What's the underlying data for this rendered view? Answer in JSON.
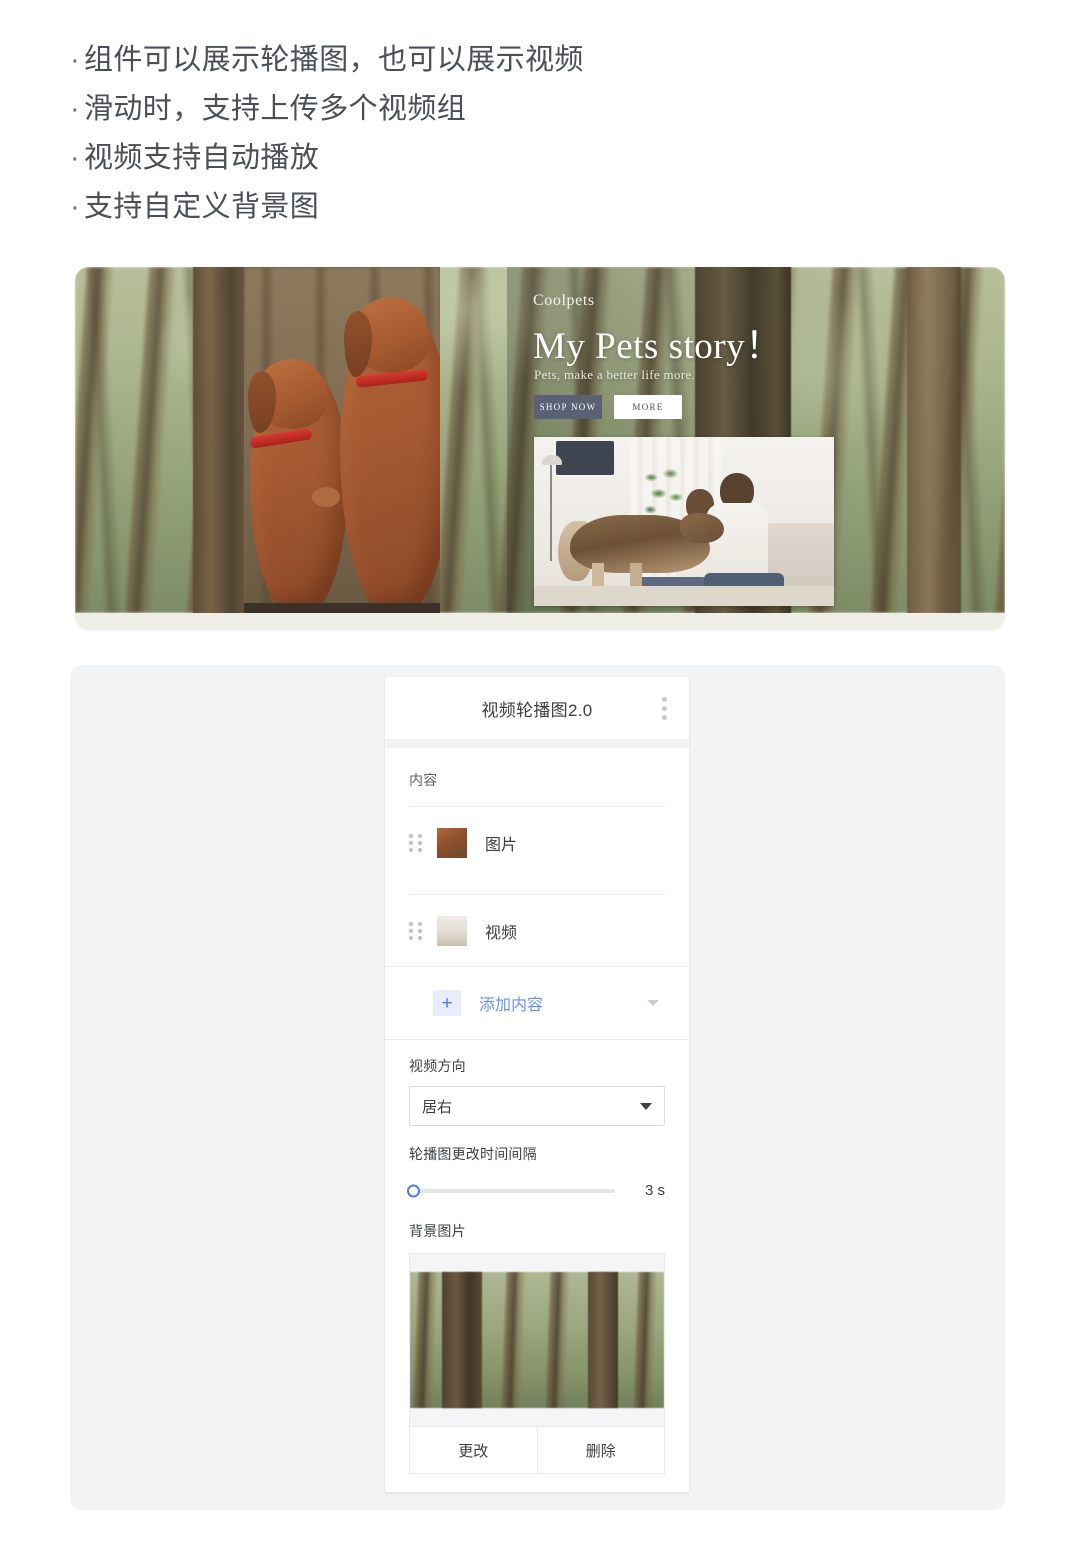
{
  "notes": {
    "bullet_marker": "·",
    "lines": [
      "组件可以展示轮播图，也可以展示视频",
      "滑动时，支持上传多个视频组",
      "视频支持自动播放",
      "支持自定义背景图"
    ]
  },
  "banner": {
    "brand": "Coolpets",
    "title": "My Pets story！",
    "subtitle": "Pets, make a better life more.",
    "primary_button": "SHOP NOW",
    "secondary_button": "MORE",
    "left_photo_alt": "两只红棕色维斯拉犬",
    "video_alt": "情侣与狗在客厅",
    "background_alt": "森林树干背景"
  },
  "editor": {
    "title": "视频轮播图2.0",
    "menu_icon": "kebab-menu-icon",
    "content_section": {
      "label": "内容",
      "items": [
        {
          "label": "图片",
          "thumb": "image-thumbnail",
          "handle": "drag-handle-icon"
        },
        {
          "label": "视频",
          "thumb": "video-thumbnail",
          "handle": "drag-handle-icon"
        }
      ],
      "add_label": "添加内容",
      "add_plus": "+",
      "add_caret": "chevron-down-icon"
    },
    "direction_field": {
      "label": "视频方向",
      "value": "居右",
      "caret": "dropdown-caret-icon"
    },
    "interval_field": {
      "label": "轮播图更改时间间隔",
      "value": "3 s",
      "slider_position_percent": 0
    },
    "background_field": {
      "label": "背景图片",
      "preview_alt": "森林树干图片预览",
      "change_button": "更改",
      "delete_button": "删除"
    }
  },
  "colors": {
    "page_bg": "#ffffff",
    "panel_bg": "#f1f3f4",
    "accent_blue": "#4d7cf3",
    "accent_blue_soft": "#6b8ef5",
    "accent_blue_bg": "#e8ecfd",
    "text_primary": "#3c4043",
    "text_secondary": "#5f6368",
    "divider": "#e8eaed",
    "banner_strip": "#f0efe7",
    "shop_button_bg": "#5a6175"
  }
}
